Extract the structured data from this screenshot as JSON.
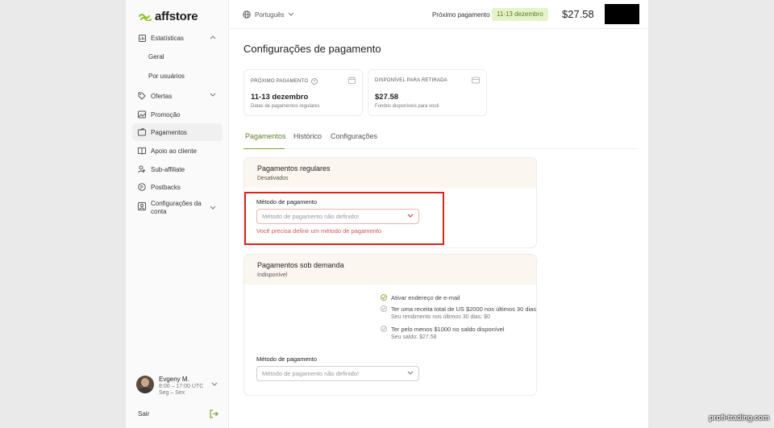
{
  "brand": {
    "name": "affstore"
  },
  "sidebar": {
    "items": [
      {
        "label": "Estatísticas",
        "icon": "chart-icon"
      },
      {
        "label": "Geral"
      },
      {
        "label": "Por usuários"
      },
      {
        "label": "Ofertas",
        "icon": "tag-icon"
      },
      {
        "label": "Promoção",
        "icon": "image-icon"
      },
      {
        "label": "Pagamentos",
        "icon": "wallet-icon"
      },
      {
        "label": "Apoio ao cliente",
        "icon": "book-icon"
      },
      {
        "label": "Sub-affiliate",
        "icon": "users-icon"
      },
      {
        "label": "Postbacks",
        "icon": "postback-icon"
      },
      {
        "label": "Configurações da conta",
        "icon": "account-icon"
      }
    ],
    "profile": {
      "name": "Evgeny M.",
      "hours": "8:00 – 17:00 UTC",
      "days": "Seg – Sex"
    },
    "logout": "Sair"
  },
  "header": {
    "language": "Português",
    "next_payment_label": "Próximo pagamento",
    "next_payment_date": "11-13 dezembro",
    "balance": "$27.58"
  },
  "page": {
    "title": "Configurações de pagamento",
    "cards": [
      {
        "label": "PRÓXIMO PAGAMENTO",
        "value": "11-13 dezembro",
        "sub": "Datas de pagamentos regulares"
      },
      {
        "label": "DISPONÍVEL PARA RETIRADA",
        "value": "$27.58",
        "sub": "Fundos disponíveis para você"
      }
    ],
    "tabs": [
      "Pagamentos",
      "Histórico",
      "Configurações"
    ],
    "regular": {
      "title": "Pagamentos regulares",
      "status": "Desativados",
      "method_label": "Método de pagamento",
      "method_placeholder": "Método de pagamento não definido!",
      "error": "Você precisa definir um método de pagamento"
    },
    "on_demand": {
      "title": "Pagamentos sob demanda",
      "status": "Indisponível",
      "requirements": [
        {
          "text": "Ativar endereço de e-mail",
          "sub": ""
        },
        {
          "text": "Ter uma receita total de US $2000 nos últimos 30 dias",
          "sub": "Seu rendimento nos últimos 30 dias: $0"
        },
        {
          "text": "Ter pelo menos $1000 no saldo disponível",
          "sub": "Seu saldo: $27.58"
        }
      ],
      "method_label": "Método de pagamento",
      "method_placeholder": "Método de pagamento não definido!"
    }
  },
  "watermark": "profi-trading.com",
  "colors": {
    "accent": "#7fa33c",
    "badge_bg": "#e4f3c9",
    "error": "#d9534f",
    "highlight": "#e02020"
  }
}
